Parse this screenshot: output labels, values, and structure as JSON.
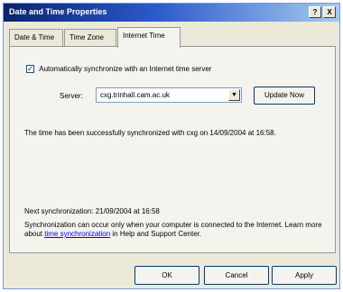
{
  "window": {
    "title": "Date and Time Properties",
    "help_label": "?",
    "close_label": "X"
  },
  "tabs": [
    {
      "label": "Date & Time",
      "active": false
    },
    {
      "label": "Time Zone",
      "active": false
    },
    {
      "label": "Internet Time",
      "active": true
    }
  ],
  "internet_time": {
    "auto_sync_checked": true,
    "auto_sync_mark": "✓",
    "auto_sync_label": "Automatically synchronize with an Internet time server",
    "server_label": "Server:",
    "server_value": "cxg.trinhall.cam.ac.uk",
    "dropdown_glyph": "▼",
    "update_button": "Update Now",
    "status_message": "The time has been successfully synchronized with cxg on 14/09/2004 at 16:58.",
    "next_sync": "Next synchronization: 21/09/2004 at 16:58",
    "note_before_link": "Synchronization can occur only when your computer is connected to the Internet.  Learn more about ",
    "note_link": "time synchronization",
    "note_after_link": " in Help and Support Center."
  },
  "buttons": {
    "ok": "OK",
    "cancel": "Cancel",
    "apply": "Apply"
  }
}
